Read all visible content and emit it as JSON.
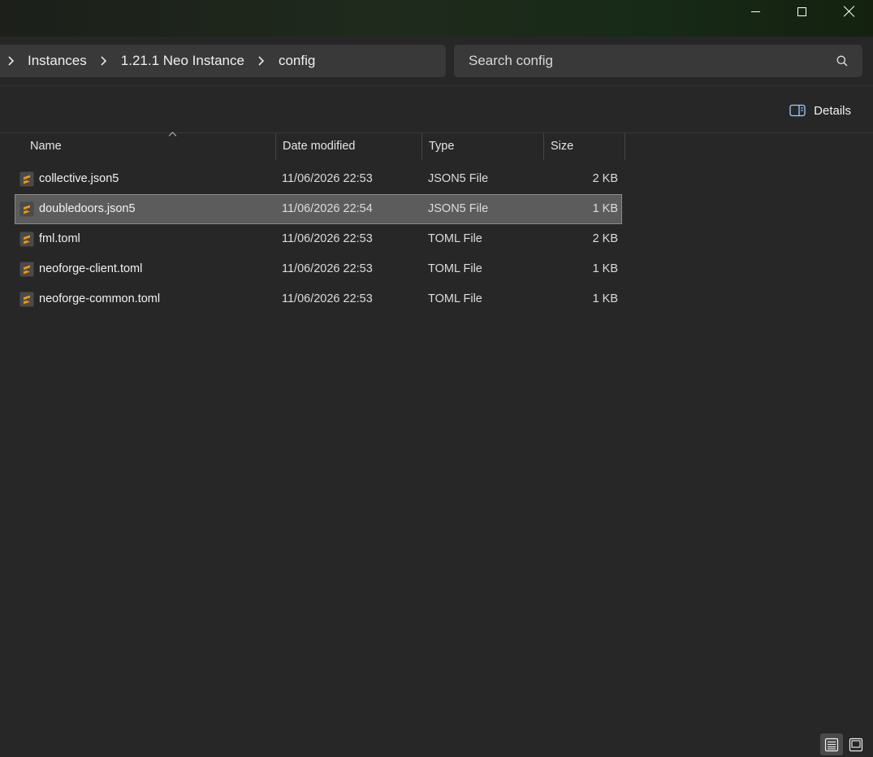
{
  "window": {
    "minimize_icon": "minimize-icon",
    "maximize_icon": "maximize-icon",
    "close_icon": "close-icon"
  },
  "breadcrumb": {
    "items": [
      "Instances",
      "1.21.1 Neo Instance",
      "config"
    ],
    "separator_icon": "chevron-right-icon"
  },
  "search": {
    "placeholder": "Search config",
    "value": "",
    "icon": "search-icon"
  },
  "commandbar": {
    "details_label": "Details",
    "details_icon": "details-pane-icon"
  },
  "columns": {
    "name": "Name",
    "date": "Date modified",
    "type": "Type",
    "size": "Size",
    "sorted_by": "Name",
    "sort_icon": "sort-ascending-icon"
  },
  "files": [
    {
      "name": "collective.json5",
      "date": "11/06/2026 22:53",
      "type": "JSON5 File",
      "size": "2 KB",
      "selected": false
    },
    {
      "name": "doubledoors.json5",
      "date": "11/06/2026 22:54",
      "type": "JSON5 File",
      "size": "1 KB",
      "selected": true
    },
    {
      "name": "fml.toml",
      "date": "11/06/2026 22:53",
      "type": "TOML File",
      "size": "2 KB",
      "selected": false
    },
    {
      "name": "neoforge-client.toml",
      "date": "11/06/2026 22:53",
      "type": "TOML File",
      "size": "1 KB",
      "selected": false
    },
    {
      "name": "neoforge-common.toml",
      "date": "11/06/2026 22:53",
      "type": "TOML File",
      "size": "1 KB",
      "selected": false
    }
  ],
  "file_icon": "sublime-text-file-icon",
  "colors": {
    "background": "#272727",
    "selection": "#5c5c5c",
    "file_icon_accent": "#ff9800"
  },
  "view_toggles": {
    "details": "details-view-icon",
    "tiles": "large-icons-view-icon",
    "active": "details"
  }
}
